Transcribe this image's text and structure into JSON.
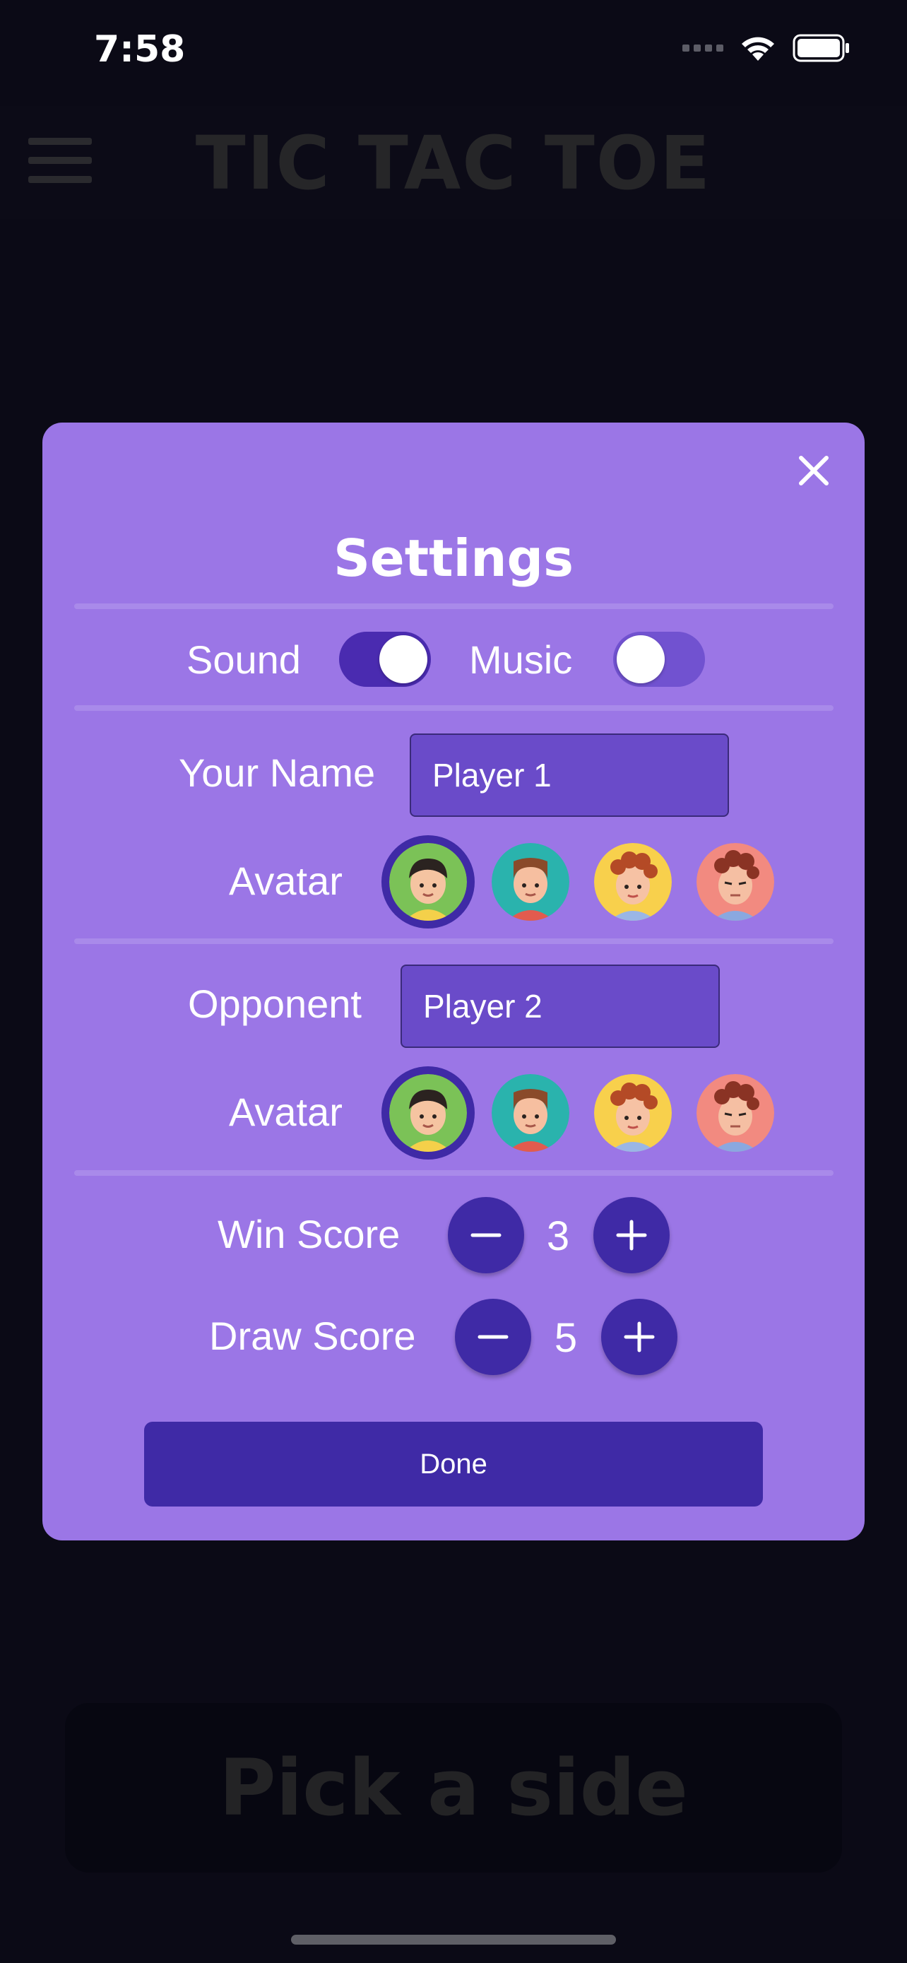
{
  "status_bar": {
    "time": "7:58"
  },
  "app": {
    "title": "TIC TAC TOE",
    "pick_side_label": "Pick a side"
  },
  "settings": {
    "title": "Settings",
    "sound_label": "Sound",
    "sound_on": true,
    "music_label": "Music",
    "music_on": false,
    "your_name_label": "Your Name",
    "your_name_value": "Player 1",
    "avatar_label": "Avatar",
    "opponent_label": "Opponent",
    "opponent_value": "Player 2",
    "win_score_label": "Win Score",
    "win_score_value": "3",
    "draw_score_label": "Draw Score",
    "draw_score_value": "5",
    "done_label": "Done",
    "selected_avatar_player": 1,
    "selected_avatar_opponent": 1
  },
  "colors": {
    "modal_bg": "#9b76e6",
    "accent": "#3f2aa6",
    "input_bg": "#6a4bc9",
    "page_bg": "#0b0a16"
  },
  "icons": [
    "menu-icon",
    "close-icon",
    "minus-icon",
    "plus-icon",
    "wifi-icon",
    "battery-icon",
    "signal-icon"
  ]
}
